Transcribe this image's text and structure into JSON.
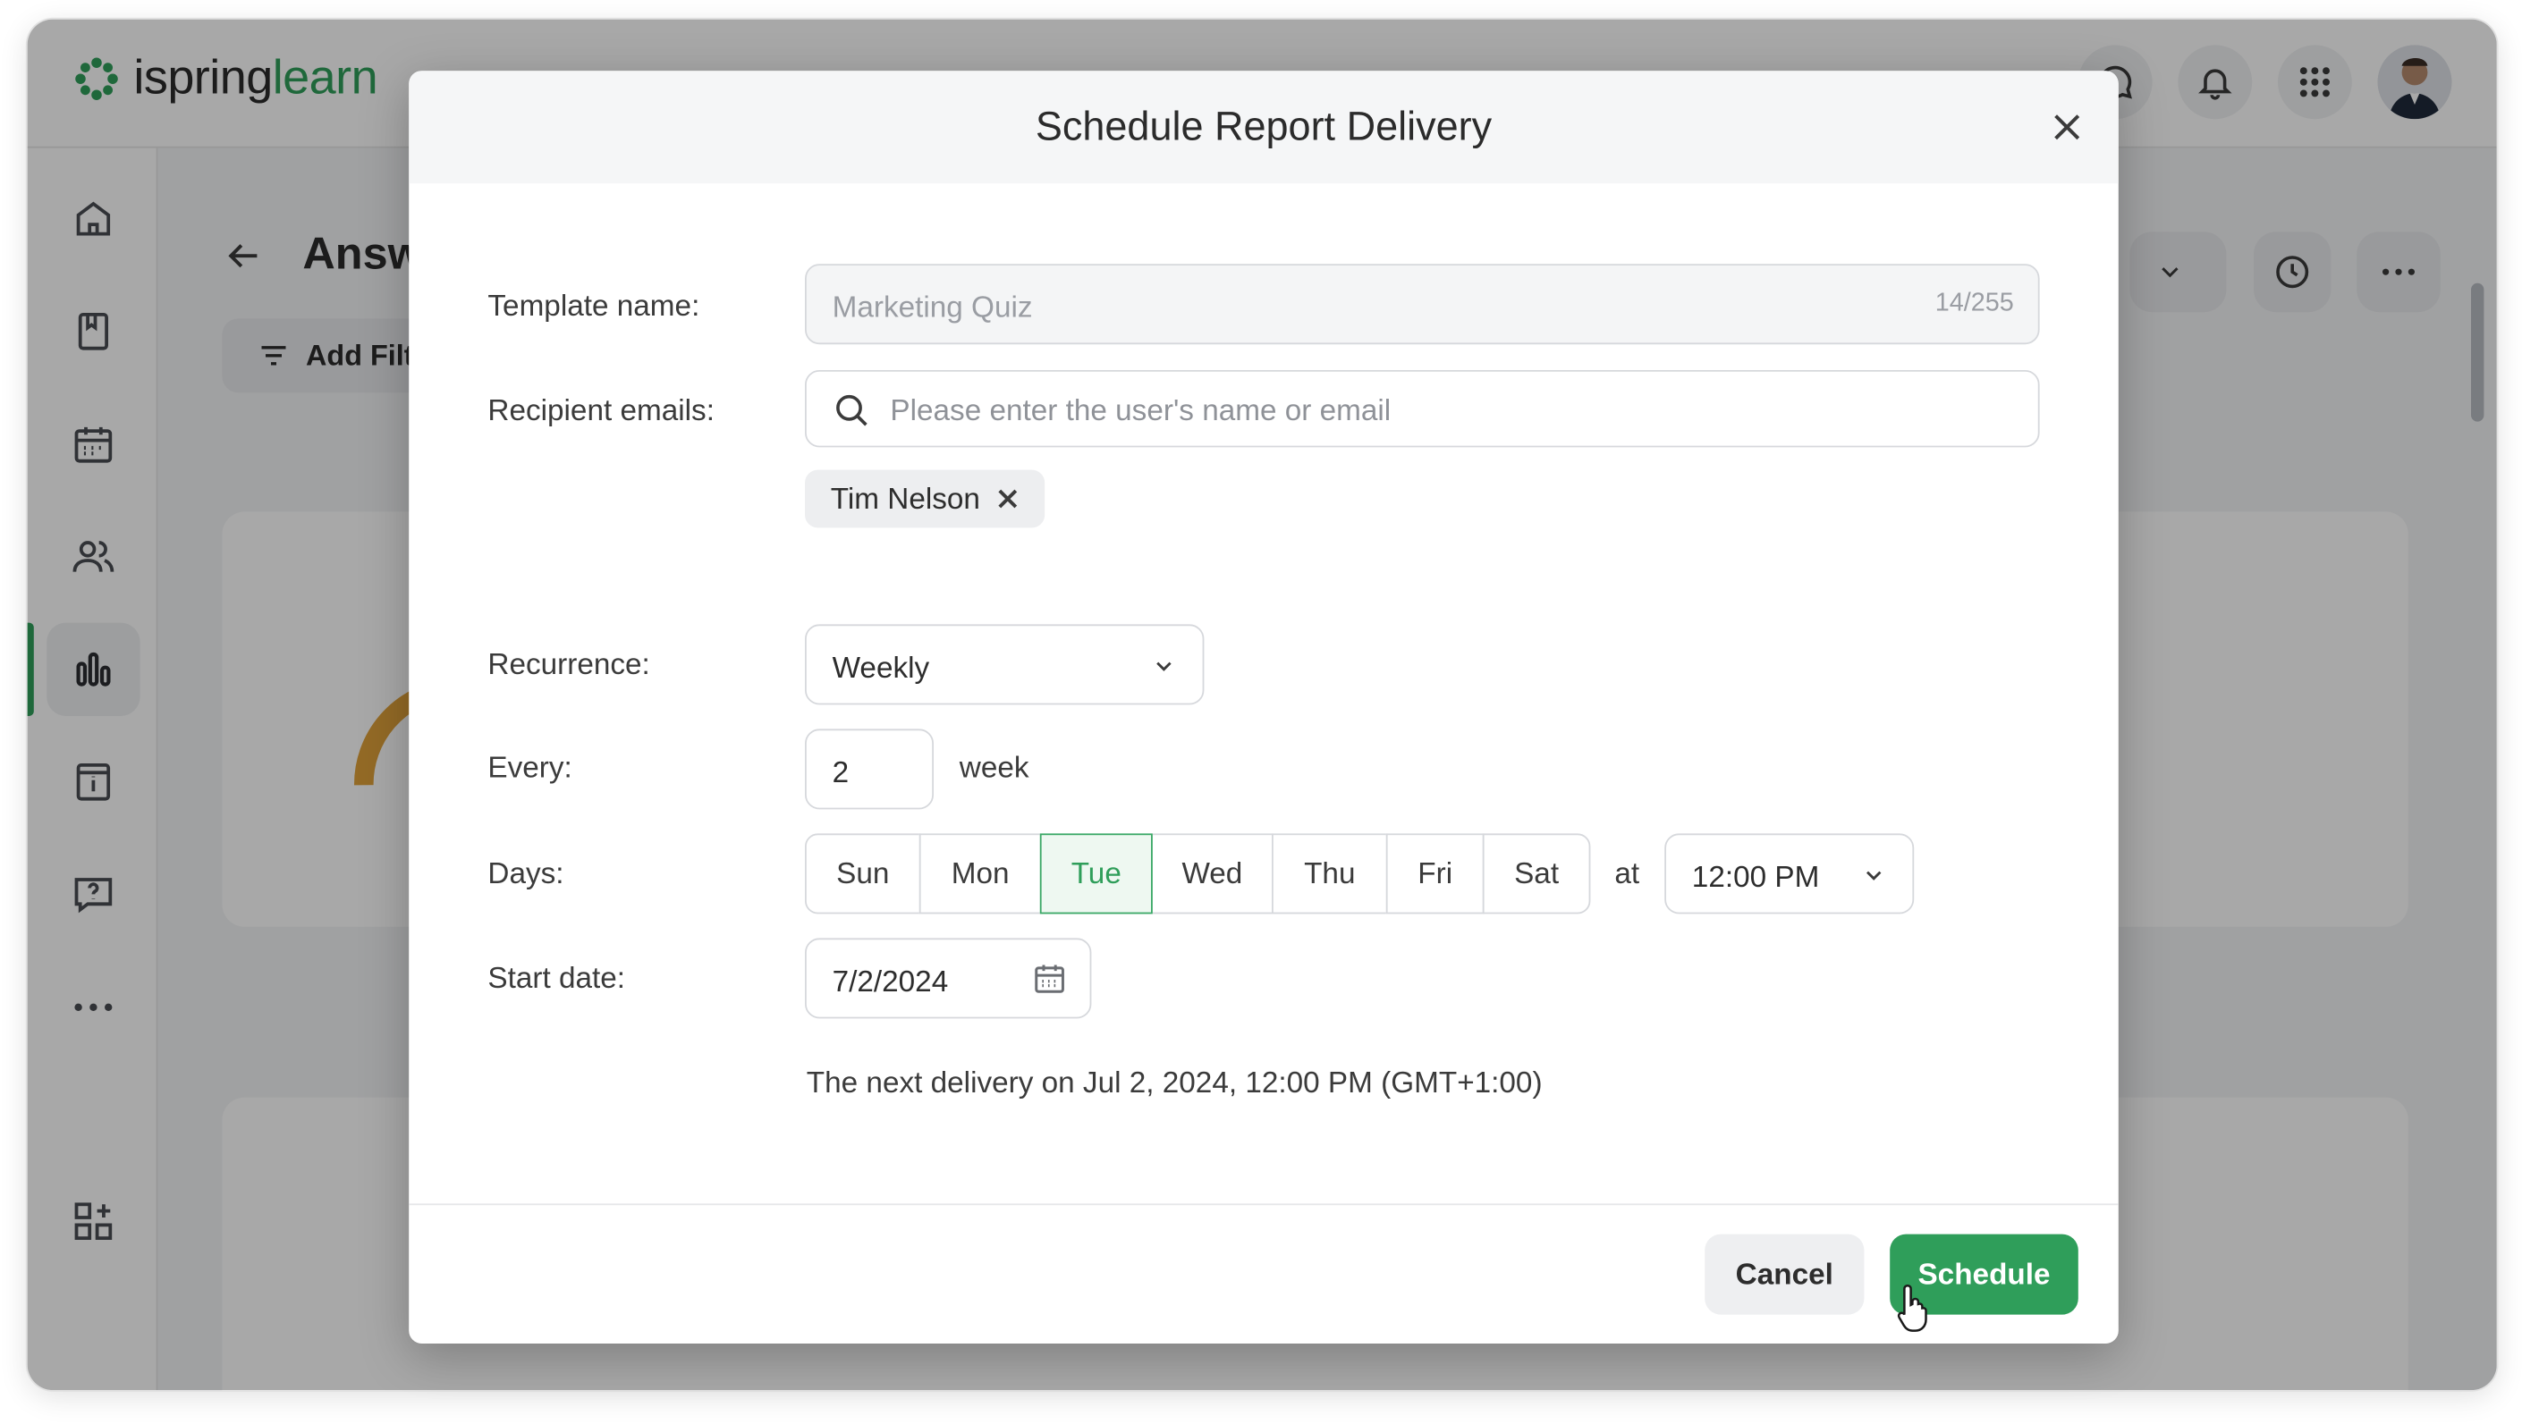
{
  "app": {
    "logo_text_main": "ispring",
    "logo_text_accent": "learn",
    "brand_color": "#2f9e5a"
  },
  "header": {
    "icons": [
      "chat-icon",
      "bell-icon",
      "apps-grid-icon",
      "user-avatar"
    ]
  },
  "sidebar": {
    "items": [
      {
        "name": "home",
        "icon": "home-icon"
      },
      {
        "name": "content",
        "icon": "book-icon"
      },
      {
        "name": "calendar",
        "icon": "calendar-icon"
      },
      {
        "name": "users",
        "icon": "users-icon"
      },
      {
        "name": "reports",
        "icon": "bar-chart-icon",
        "active": true
      },
      {
        "name": "info",
        "icon": "info-icon"
      },
      {
        "name": "questions",
        "icon": "question-bubble-icon"
      },
      {
        "name": "more",
        "icon": "more-icon"
      },
      {
        "name": "add-widgets",
        "icon": "widgets-icon"
      }
    ]
  },
  "background_page": {
    "title": "Answ",
    "add_filter_label": "Add Filt"
  },
  "modal": {
    "title": "Schedule Report Delivery",
    "template_name_label": "Template name:",
    "template_name_value": "Marketing Quiz",
    "template_name_counter": "14/255",
    "recipient_label": "Recipient emails:",
    "recipient_placeholder": "Please enter the user's name or email",
    "recipients": [
      "Tim Nelson"
    ],
    "recurrence_label": "Recurrence:",
    "recurrence_value": "Weekly",
    "every_label": "Every:",
    "every_value": "2",
    "every_unit": "week",
    "days_label": "Days:",
    "days": [
      {
        "label": "Sun",
        "selected": false
      },
      {
        "label": "Mon",
        "selected": false
      },
      {
        "label": "Tue",
        "selected": true
      },
      {
        "label": "Wed",
        "selected": false
      },
      {
        "label": "Thu",
        "selected": false
      },
      {
        "label": "Fri",
        "selected": false
      },
      {
        "label": "Sat",
        "selected": false
      }
    ],
    "at_label": "at",
    "time_value": "12:00 PM",
    "start_date_label": "Start date:",
    "start_date_value": "7/2/2024",
    "next_delivery_text": "The next delivery on Jul 2, 2024, 12:00 PM (GMT+1:00)",
    "cancel_label": "Cancel",
    "schedule_label": "Schedule"
  }
}
